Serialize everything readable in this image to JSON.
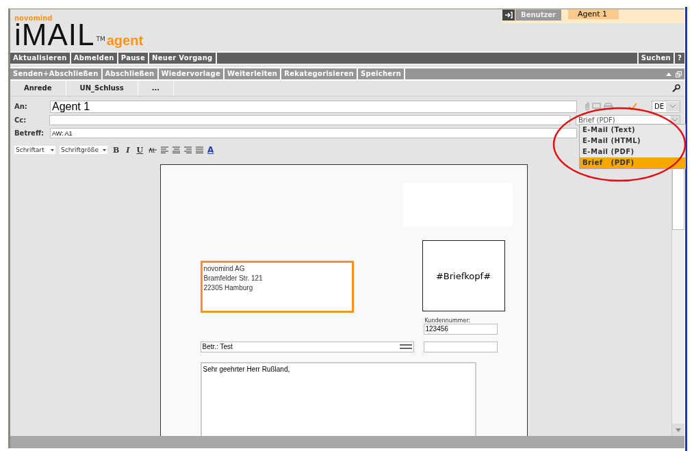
{
  "logo": {
    "brand": "novomind",
    "product": "iMAIL",
    "trademark": "TM",
    "suffix": "agent"
  },
  "user": {
    "label": "Benutzer",
    "name": "Agent 1"
  },
  "main_menu": [
    "Aktualisieren",
    "Abmelden",
    "Pause",
    "Neuer Vorgang"
  ],
  "main_menu_right": [
    "Suchen",
    "?"
  ],
  "action_menu": [
    "Senden+Abschließen",
    "Abschließen",
    "Wiedervorlage",
    "Weiterleiten",
    "Rekategorisieren",
    "Speichern"
  ],
  "text_tabs": [
    "Anrede",
    "UN_Schluss",
    "..."
  ],
  "fields": [
    {
      "label": "An:",
      "value": "Agent 1",
      "kind": "large"
    },
    {
      "label": "Cc:",
      "kind": "normal"
    },
    {
      "label": "Betreff:",
      "value": "AW: A1",
      "kind": "normal"
    }
  ],
  "language": "DE",
  "format_select": {
    "value": "Brief   (PDF)",
    "expanded": true,
    "options": [
      {
        "label": "E-Mail (Text)",
        "selected": false
      },
      {
        "label": "E-Mail (HTML)",
        "selected": false
      },
      {
        "label": "E-Mail (PDF)",
        "selected": false
      },
      {
        "label": "Brief   (PDF)",
        "selected": true
      }
    ]
  },
  "toolbar": {
    "font": "Schriftart",
    "size": "Schriftgröße",
    "buttons": [
      {
        "kind": "bold",
        "label": "B"
      },
      {
        "kind": "italic",
        "label": "I"
      },
      {
        "kind": "underline",
        "label": "U"
      }
    ],
    "color_label": "A"
  },
  "letter": {
    "address": [
      "novomind AG",
      "Bramfelder Str. 121",
      "22305 Hamburg"
    ],
    "letterhead": "#Briefkopf#",
    "customer_label": "Kundennummer:",
    "customer_number": "123456",
    "subject": "Betr.: Test",
    "salutation": "Sehr geehrter Herr Rußland,"
  }
}
